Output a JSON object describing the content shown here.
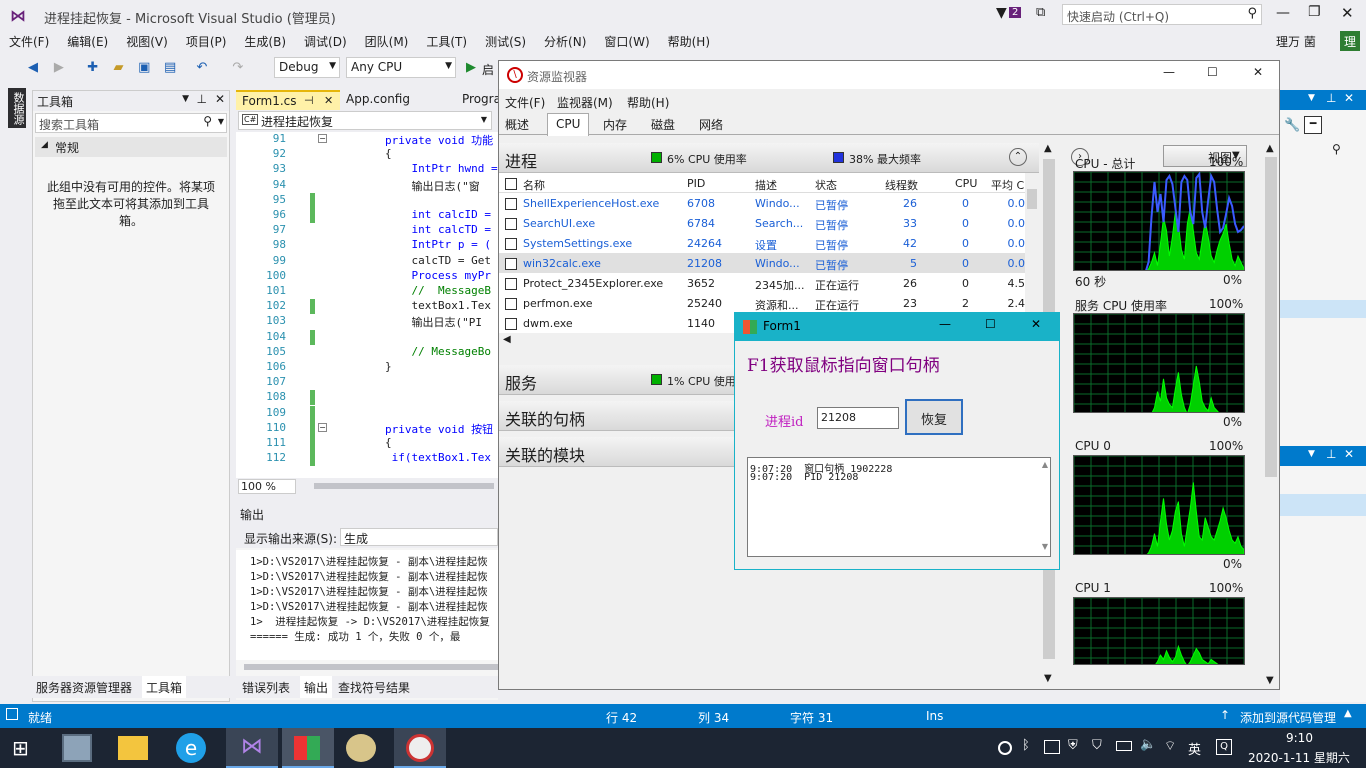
{
  "vs": {
    "title": "进程挂起恢复 - Microsoft Visual Studio (管理员)",
    "notif_count": "2",
    "quick_launch_placeholder": "快速启动 (Ctrl+Q)",
    "user": "理万 菌",
    "user_badge": "理",
    "menu": [
      "文件(F)",
      "编辑(E)",
      "视图(V)",
      "项目(P)",
      "生成(B)",
      "调试(D)",
      "团队(M)",
      "工具(T)",
      "测试(S)",
      "分析(N)",
      "窗口(W)",
      "帮助(H)"
    ],
    "config": "Debug",
    "platform": "Any CPU",
    "start_label": "启",
    "side_tab": "数据源",
    "toolbox": {
      "title": "工具箱",
      "search_placeholder": "搜索工具箱",
      "group": "常规",
      "empty_text": "此组中没有可用的控件。将某项拖至此文本可将其添加到工具箱。",
      "bottom_tabs": [
        "服务器资源管理器",
        "工具箱"
      ]
    },
    "editor": {
      "tabs": [
        "Form1.cs",
        "App.config",
        "Progra"
      ],
      "nav_combo": "进程挂起恢复",
      "zoom": "100 %",
      "lines": [
        {
          "n": "91",
          "code": "        private void 功能"
        },
        {
          "n": "92",
          "code": "        {"
        },
        {
          "n": "93",
          "code": "            IntPtr hwnd ="
        },
        {
          "n": "94",
          "code": "            输出日志(\"窗"
        },
        {
          "n": "95",
          "code": ""
        },
        {
          "n": "96",
          "code": "            int calcID ="
        },
        {
          "n": "97",
          "code": "            int calcTD ="
        },
        {
          "n": "98",
          "code": "            IntPtr p = ("
        },
        {
          "n": "99",
          "code": "            calcTD = Get"
        },
        {
          "n": "100",
          "code": "            Process myPr"
        },
        {
          "n": "101",
          "code": "            //  MessageB"
        },
        {
          "n": "102",
          "code": "            textBox1.Tex"
        },
        {
          "n": "103",
          "code": "            输出日志(\"PI"
        },
        {
          "n": "104",
          "code": ""
        },
        {
          "n": "105",
          "code": "            // MessageBo"
        },
        {
          "n": "106",
          "code": "        }"
        },
        {
          "n": "107",
          "code": ""
        },
        {
          "n": "108",
          "code": ""
        },
        {
          "n": "109",
          "code": ""
        },
        {
          "n": "110",
          "code": "        private void 按钮"
        },
        {
          "n": "111",
          "code": "        {"
        },
        {
          "n": "112",
          "code": "         if(textBox1.Tex"
        }
      ]
    },
    "output": {
      "title": "输出",
      "source_label": "显示输出来源(S):",
      "source_value": "生成",
      "lines": [
        "1>D:\\VS2017\\进程挂起恢复 - 副本\\进程挂起恢",
        "1>D:\\VS2017\\进程挂起恢复 - 副本\\进程挂起恢",
        "1>D:\\VS2017\\进程挂起恢复 - 副本\\进程挂起恢",
        "1>D:\\VS2017\\进程挂起恢复 - 副本\\进程挂起恢",
        "1>  进程挂起恢复 -> D:\\VS2017\\进程挂起恢复",
        "====== 生成: 成功 1 个，失败 0 个，最"
      ],
      "bottom_tabs": [
        "错误列表",
        "输出",
        "查找符号结果"
      ]
    },
    "status": {
      "ready": "就绪",
      "row": "行 42",
      "col": "列 34",
      "ch": "字符 31",
      "ins": "Ins",
      "source_control": "添加到源代码管理"
    }
  },
  "resmon": {
    "title": "资源监视器",
    "menu": [
      "文件(F)",
      "监视器(M)",
      "帮助(H)"
    ],
    "tabs": [
      "概述",
      "CPU",
      "内存",
      "磁盘",
      "网络"
    ],
    "active_tab": "CPU",
    "process_section": {
      "title": "进程",
      "cpu_usage": "6% CPU 使用率",
      "max_freq": "38% 最大频率",
      "columns": [
        "名称",
        "PID",
        "描述",
        "状态",
        "线程数",
        "CPU",
        "平均 C"
      ],
      "rows": [
        {
          "name": "ShellExperienceHost.exe",
          "pid": "6708",
          "desc": "Windo...",
          "status": "已暂停",
          "threads": "26",
          "cpu": "0",
          "avg": "0.0",
          "suspended": true
        },
        {
          "name": "SearchUI.exe",
          "pid": "6784",
          "desc": "Search...",
          "status": "已暂停",
          "threads": "33",
          "cpu": "0",
          "avg": "0.0",
          "suspended": true
        },
        {
          "name": "SystemSettings.exe",
          "pid": "24264",
          "desc": "设置",
          "status": "已暂停",
          "threads": "42",
          "cpu": "0",
          "avg": "0.0",
          "suspended": true
        },
        {
          "name": "win32calc.exe",
          "pid": "21208",
          "desc": "Windo...",
          "status": "已暂停",
          "threads": "5",
          "cpu": "0",
          "avg": "0.0",
          "suspended": true
        },
        {
          "name": "Protect_2345Explorer.exe",
          "pid": "3652",
          "desc": "2345加...",
          "status": "正在运行",
          "threads": "26",
          "cpu": "0",
          "avg": "4.5",
          "suspended": false
        },
        {
          "name": "perfmon.exe",
          "pid": "25240",
          "desc": "资源和...",
          "status": "正在运行",
          "threads": "23",
          "cpu": "2",
          "avg": "2.4",
          "suspended": false
        },
        {
          "name": "dwm.exe",
          "pid": "1140",
          "desc": "",
          "status": "",
          "threads": "",
          "cpu": "",
          "avg": "",
          "suspended": false
        }
      ]
    },
    "services_section": {
      "title": "服务",
      "cpu_usage": "1% CPU 使用"
    },
    "handles_section": {
      "title": "关联的句柄"
    },
    "modules_section": {
      "title": "关联的模块"
    },
    "view_button": "视图",
    "graphs": [
      {
        "title": "CPU - 总计",
        "max": "100%",
        "left_footer": "60 秒",
        "right_footer": "0%"
      },
      {
        "title": "服务 CPU 使用率",
        "max": "100%",
        "left_footer": "",
        "right_footer": "0%"
      },
      {
        "title": "CPU 0",
        "max": "100%",
        "left_footer": "",
        "right_footer": "0%"
      },
      {
        "title": "CPU 1",
        "max": "100%",
        "left_footer": "",
        "right_footer": ""
      }
    ]
  },
  "form1": {
    "title": "Form1",
    "heading": "F1获取鼠标指向窗口句柄",
    "pid_label": "进程id",
    "pid_value": "21208",
    "restore_button": "恢复",
    "log": [
      "9:07:20  窗口句柄 1902228",
      "9:07:20  PID 21208"
    ]
  },
  "taskbar": {
    "time": "9:10",
    "date": "2020-1-11 星期六",
    "ime": "英"
  },
  "colors": {
    "vs_blue": "#007acc",
    "graph_green": "#00d000",
    "graph_blue": "#3b5bff",
    "form_heading": "#800080",
    "suspended_blue": "#1a5fd6"
  }
}
